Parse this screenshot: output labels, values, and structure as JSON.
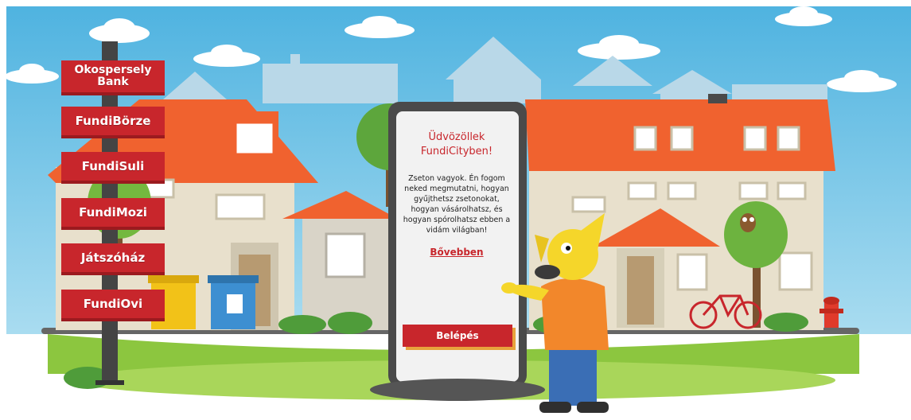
{
  "nav": {
    "items": [
      {
        "label": "Okospersely\nBank"
      },
      {
        "label": "FundiBörze"
      },
      {
        "label": "FundiSuli"
      },
      {
        "label": "FundiMozi"
      },
      {
        "label": "Játszóház"
      },
      {
        "label": "FundiOvi"
      }
    ]
  },
  "pillar": {
    "welcome": "Üdvözöllek FundiCityben!",
    "intro": "Zseton vagyok. Én fogom neked megmutatni, hogyan gyűjthetsz zsetonokat, hogyan vásárolhatsz, és hogyan spórolhatsz ebben a vidám világban!",
    "more_link": "Bővebben",
    "login_button": "Belépés"
  },
  "colors": {
    "sign_red": "#c8262c",
    "sky_blue": "#6cc3e6",
    "roof_orange": "#f0622f",
    "grass_green": "#8cc63f"
  }
}
